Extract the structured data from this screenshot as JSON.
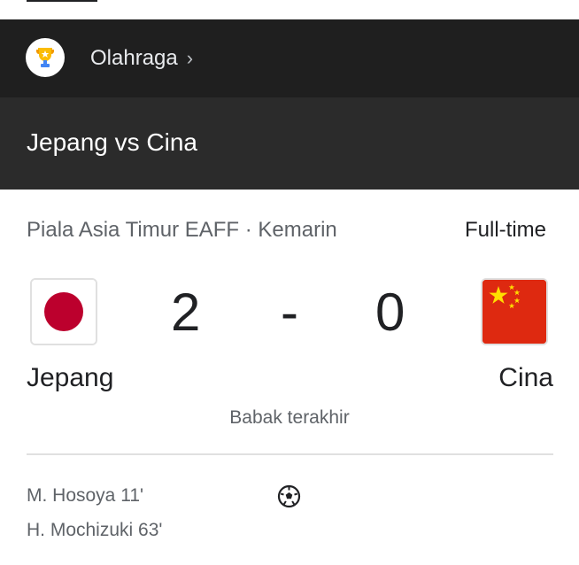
{
  "header": {
    "category_label": "Olahraga",
    "category_icon": "trophy-icon",
    "chevron_icon": "chevron-right-icon",
    "chevron_glyph": "›",
    "match_title": "Jepang vs Cina"
  },
  "match": {
    "competition_meta": "Piala Asia Timur EAFF · Kemarin",
    "status": "Full-time",
    "period_label": "Babak terakhir",
    "home": {
      "name": "Jepang",
      "score": "2",
      "flag_icon": "japan-flag-icon"
    },
    "separator": "-",
    "away": {
      "name": "Cina",
      "score": "0",
      "flag_icon": "china-flag-icon"
    }
  },
  "goals": {
    "icon": "soccer-ball-icon",
    "home_scorers": [
      "M. Hosoya 11'",
      "H. Mochizuki 63'"
    ]
  },
  "colors": {
    "header_dark": "#1f1f1f",
    "header_title_bg": "#2b2b2b",
    "japan_red": "#bc002d",
    "china_red": "#de2910",
    "china_star": "#ffde00"
  }
}
